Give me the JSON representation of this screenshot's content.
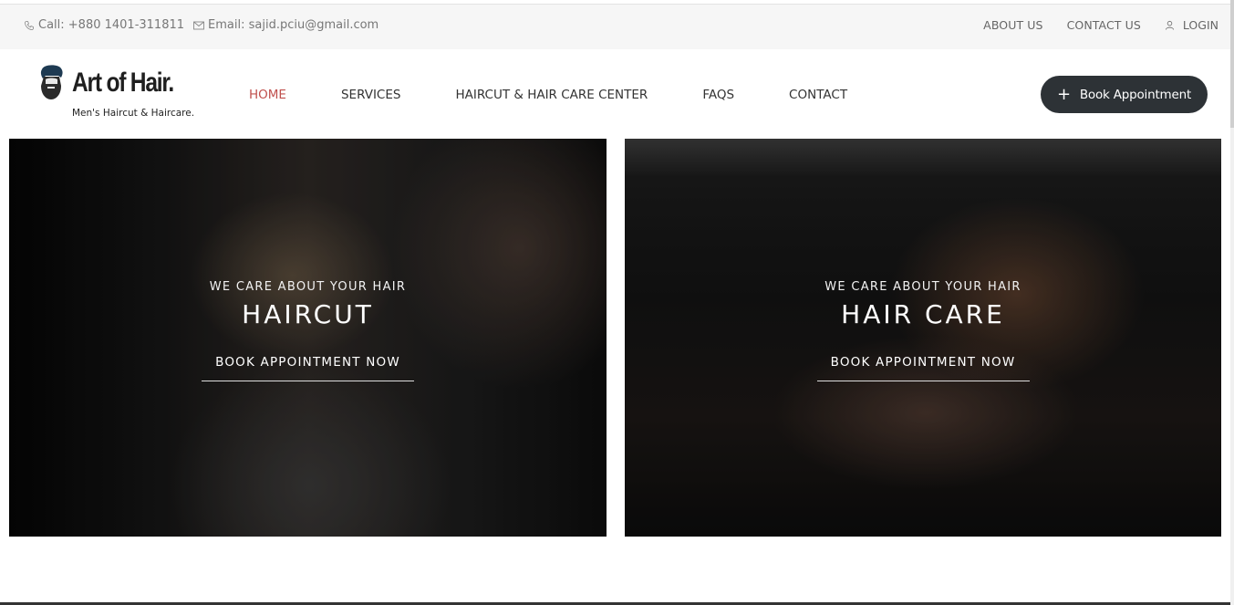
{
  "topbar": {
    "phone": "Call: +880 1401-311811",
    "email": "Email: sajid.pciu@gmail.com",
    "links": [
      "ABOUT US",
      "CONTACT US"
    ],
    "login": "LOGIN"
  },
  "header": {
    "logo_name": "Art of Hair.",
    "logo_tagline": "Men's Haircut & Haircare.",
    "nav": [
      "HOME",
      "SERVICES",
      "HAIRCUT & HAIR CARE CENTER",
      "FAQS",
      "CONTACT"
    ],
    "active_nav": "HOME",
    "book_button": "Book Appointment"
  },
  "cards": [
    {
      "kicker": "WE CARE ABOUT YOUR HAIR",
      "title": "HAIRCUT",
      "cta": "BOOK APPOINTMENT NOW"
    },
    {
      "kicker": "WE CARE ABOUT YOUR HAIR",
      "title": "HAIR CARE",
      "cta": "BOOK APPOINTMENT NOW"
    }
  ],
  "colors": {
    "accent": "#c0504d",
    "button_bg": "#2d3236",
    "topbar_bg": "#f6f6f6"
  }
}
